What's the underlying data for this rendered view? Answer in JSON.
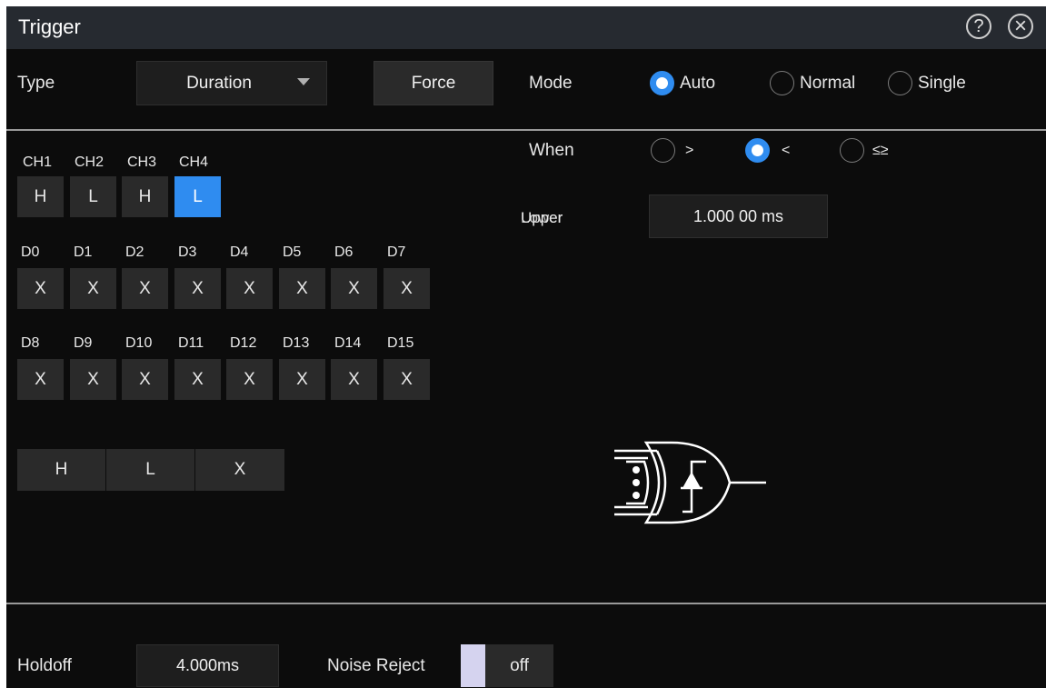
{
  "window": {
    "title": "Trigger",
    "help_icon": "?",
    "close_icon": "×"
  },
  "type": {
    "label": "Type",
    "value": "Duration"
  },
  "force_label": "Force",
  "mode": {
    "label": "Mode",
    "options": [
      "Auto",
      "Normal",
      "Single"
    ],
    "selected": "Auto"
  },
  "when": {
    "label": "When",
    "options": [
      ">",
      "<",
      "≤≥"
    ],
    "selected": "<"
  },
  "upper": {
    "label": "Upper",
    "overlap_label": "Lower",
    "value": "1.000 00 ms"
  },
  "channels": {
    "labels": [
      "CH1",
      "CH2",
      "CH3",
      "CH4"
    ],
    "values": [
      "H",
      "L",
      "H",
      "L"
    ],
    "active_index": 3
  },
  "digital_row1": {
    "labels": [
      "D0",
      "D1",
      "D2",
      "D3",
      "D4",
      "D5",
      "D6",
      "D7"
    ],
    "values": [
      "X",
      "X",
      "X",
      "X",
      "X",
      "X",
      "X",
      "X"
    ]
  },
  "digital_row2": {
    "labels": [
      "D8",
      "D9",
      "D10",
      "D11",
      "D12",
      "D13",
      "D14",
      "D15"
    ],
    "values": [
      "X",
      "X",
      "X",
      "X",
      "X",
      "X",
      "X",
      "X"
    ]
  },
  "quick_set": [
    "H",
    "L",
    "X"
  ],
  "holdoff": {
    "label": "Holdoff",
    "value": "4.000ms"
  },
  "noise_reject": {
    "label": "Noise Reject",
    "value": "off"
  },
  "colors": {
    "accent": "#2f8cf0",
    "panel_bg": "#0c0c0c",
    "title_bg": "#262a30"
  },
  "icons": {
    "diagram": "duration-trigger-gate-icon"
  }
}
